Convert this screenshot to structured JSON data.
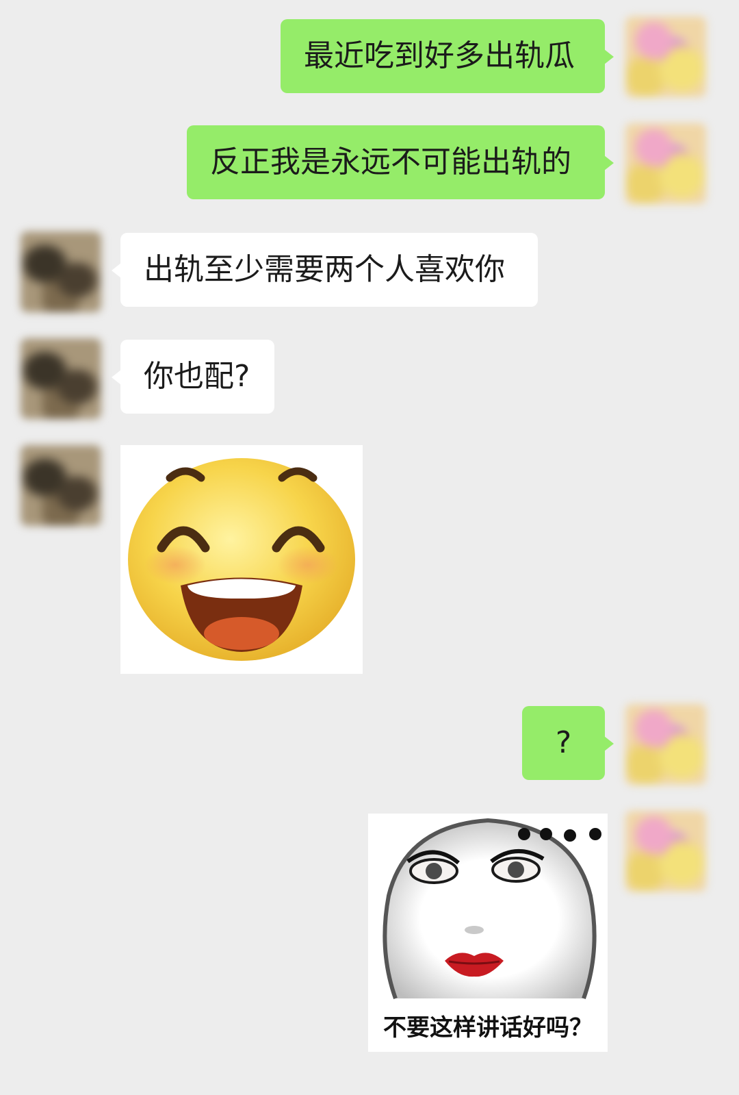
{
  "messages": [
    {
      "sender": "me",
      "type": "text",
      "text": "最近吃到好多出轨瓜"
    },
    {
      "sender": "me",
      "type": "text",
      "text": "反正我是永远不可能出轨的"
    },
    {
      "sender": "other",
      "type": "text",
      "text": "出轨至少需要两个人喜欢你"
    },
    {
      "sender": "other",
      "type": "text",
      "text": "你也配?"
    },
    {
      "sender": "other",
      "type": "sticker",
      "sticker": "laughing-emoji-sticker"
    },
    {
      "sender": "me",
      "type": "text",
      "text": "?"
    },
    {
      "sender": "me",
      "type": "sticker",
      "sticker": "meme-face-sticker",
      "caption": "不要这样讲话好吗？"
    }
  ],
  "colors": {
    "background": "#ededed",
    "my_bubble": "#95ec69",
    "other_bubble": "#ffffff"
  }
}
